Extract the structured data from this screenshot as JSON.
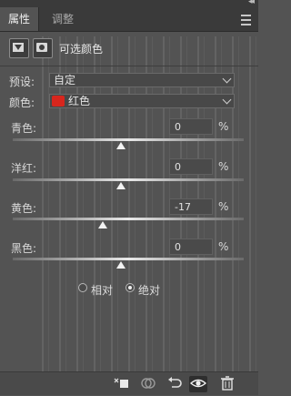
{
  "panel": {
    "tabs": [
      {
        "label": "属性",
        "active": true
      },
      {
        "label": "调整",
        "active": false
      }
    ],
    "collapse_glyph": "◂◂",
    "menu_icon": "hamburger-menu-icon"
  },
  "header": {
    "icons": [
      "adjustment-layer-icon",
      "layer-mask-icon"
    ],
    "title": "可选颜色"
  },
  "preset": {
    "label": "预设:",
    "value": "自定"
  },
  "colors": {
    "label": "颜色:",
    "value": "红色",
    "swatch_color": "#d8261d"
  },
  "sliders": [
    {
      "label": "青色:",
      "value": "0",
      "unit": "%",
      "level": 0.47
    },
    {
      "label": "洋红:",
      "value": "0",
      "unit": "%",
      "level": 0.47
    },
    {
      "label": "黄色:",
      "value": "-17",
      "unit": "%",
      "level": 0.39
    },
    {
      "label": "黑色:",
      "value": "0",
      "unit": "%",
      "level": 0.47
    }
  ],
  "method": {
    "options": [
      {
        "label": "相对",
        "selected": false
      },
      {
        "label": "绝对",
        "selected": true
      }
    ]
  },
  "footer": {
    "icons": [
      "clip-to-layer-icon",
      "view-previous-state-icon",
      "reset-icon",
      "visibility-eye-icon",
      "trash-icon"
    ]
  },
  "colors_theme": {
    "panel_bg": "#535353",
    "tab_bar_bg": "#3a3a3a",
    "accent_red": "#d8261d"
  }
}
